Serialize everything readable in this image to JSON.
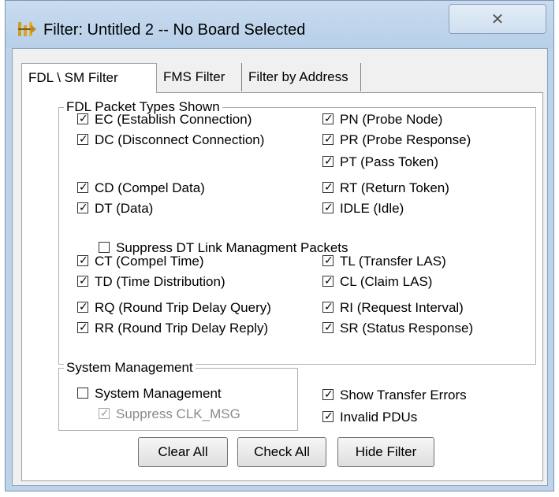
{
  "window": {
    "title": "Filter: Untitled 2 -- No Board Selected",
    "close_glyph": "✕",
    "icons": {
      "app": "filter-icon",
      "close": "close-icon"
    }
  },
  "tabs": [
    {
      "label": "FDL \\ SM Filter",
      "active": true
    },
    {
      "label": "FMS Filter",
      "active": false
    },
    {
      "label": "Filter by Address",
      "active": false
    }
  ],
  "fdl_group": {
    "title": "FDL Packet Types Shown",
    "left_items": [
      {
        "label": "EC (Establish Connection)",
        "checked": true
      },
      {
        "label": "DC (Disconnect Connection)",
        "checked": true
      },
      {
        "label": "CD (Compel Data)",
        "checked": true
      },
      {
        "label": "DT (Data)",
        "checked": true
      },
      {
        "label": "CT (Compel Time)",
        "checked": true
      },
      {
        "label": "TD (Time Distribution)",
        "checked": true
      },
      {
        "label": "RQ (Round Trip Delay Query)",
        "checked": true
      },
      {
        "label": "RR (Round Trip Delay Reply)",
        "checked": true
      }
    ],
    "right_items": [
      {
        "label": "PN (Probe Node)",
        "checked": true
      },
      {
        "label": "PR (Probe Response)",
        "checked": true
      },
      {
        "label": "PT (Pass Token)",
        "checked": true
      },
      {
        "label": "RT (Return Token)",
        "checked": true
      },
      {
        "label": "IDLE (Idle)",
        "checked": true
      },
      {
        "label": "TL (Transfer LAS)",
        "checked": true
      },
      {
        "label": "CL (Claim LAS)",
        "checked": true
      },
      {
        "label": "RI (Request Interval)",
        "checked": true
      },
      {
        "label": "SR (Status Response)",
        "checked": true
      }
    ],
    "suppress_dt": {
      "label": "Suppress DT Link Managment Packets",
      "checked": false
    }
  },
  "sm_group": {
    "title": "System Management",
    "system_management": {
      "label": "System Management",
      "checked": false
    },
    "suppress_clk": {
      "label": "Suppress CLK_MSG",
      "checked": true,
      "disabled": true
    }
  },
  "extra": {
    "show_transfer_errors": {
      "label": "Show Transfer Errors",
      "checked": true
    },
    "invalid_pdus": {
      "label": "Invalid PDUs",
      "checked": true
    }
  },
  "buttons": {
    "clear_all": "Clear All",
    "check_all": "Check All",
    "hide_filter": "Hide Filter"
  },
  "check_glyph": "✓"
}
